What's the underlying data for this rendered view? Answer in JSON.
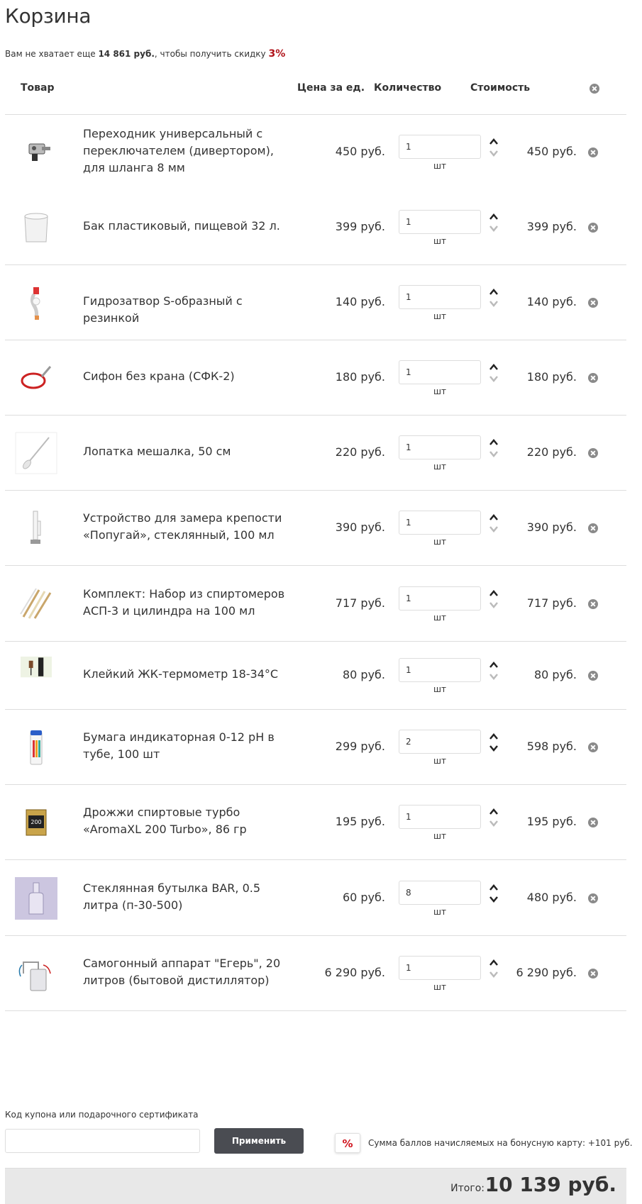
{
  "page": {
    "title": "Корзина",
    "notice_prefix": "Вам не хватает еще ",
    "notice_amount": "14 861 руб.",
    "notice_middle": ", чтобы получить скидку ",
    "notice_discount": "3%"
  },
  "table": {
    "headers": {
      "product": "Товар",
      "unit_price": "Цена за ед.",
      "quantity": "Количество",
      "cost": "Стоимость"
    },
    "rows": [
      {
        "name": "Переходник универсальный с переключателем (дивертором), для шланга 8 мм",
        "price": "450 руб.",
        "qty": "1",
        "unit": "шт",
        "total": "450 руб.",
        "icon": "adapter-image"
      },
      {
        "name": "Бак пластиковый, пищевой 32 л.",
        "price": "399 руб.",
        "qty": "1",
        "unit": "шт",
        "total": "399 руб.",
        "icon": "plastic-tank-image"
      },
      {
        "name": "Гидрозатвор S-образный с резинкой",
        "price": "140 руб.",
        "qty": "1",
        "unit": "шт",
        "total": "140 руб.",
        "icon": "airlock-image"
      },
      {
        "name": "Сифон без крана (СФК-2)",
        "price": "180 руб.",
        "qty": "1",
        "unit": "шт",
        "total": "180 руб.",
        "icon": "siphon-image"
      },
      {
        "name": "Лопатка мешалка, 50 см",
        "price": "220 руб.",
        "qty": "1",
        "unit": "шт",
        "total": "220 руб.",
        "icon": "stirrer-image"
      },
      {
        "name": "Устройство для замера крепости «Попугай», стеклянный, 100 мл",
        "price": "390 руб.",
        "qty": "1",
        "unit": "шт",
        "total": "390 руб.",
        "icon": "parrot-device-image"
      },
      {
        "name": "Комплект: Набор из спиртомеров АСП-3 и цилиндра на 100 мл",
        "price": "717 руб.",
        "qty": "1",
        "unit": "шт",
        "total": "717 руб.",
        "icon": "hydrometer-set-image"
      },
      {
        "name": "Клейкий ЖК-термометр 18-34°С",
        "price": "80 руб.",
        "qty": "1",
        "unit": "шт",
        "total": "80 руб.",
        "icon": "thermometer-image"
      },
      {
        "name": "Бумага индикаторная 0-12 рН в тубе, 100 шт",
        "price": "299 руб.",
        "qty": "2",
        "unit": "шт",
        "total": "598 руб.",
        "icon": "ph-paper-image"
      },
      {
        "name": "Дрожжи спиртовые турбо «AromaXL 200 Turbo», 86 гр",
        "price": "195 руб.",
        "qty": "1",
        "unit": "шт",
        "total": "195 руб.",
        "icon": "yeast-image"
      },
      {
        "name": "Стеклянная бутылка BAR, 0.5 литра (п-30-500)",
        "price": "60 руб.",
        "qty": "8",
        "unit": "шт",
        "total": "480 руб.",
        "icon": "bottle-image"
      },
      {
        "name": "Самогонный аппарат \"Егерь\", 20 литров (бытовой дистиллятор)",
        "price": "6 290 руб.",
        "qty": "1",
        "unit": "шт",
        "total": "6 290 руб.",
        "icon": "distiller-image"
      }
    ]
  },
  "coupon": {
    "label": "Код купона или подарочного сертификата",
    "value": "",
    "apply_label": "Применить"
  },
  "bonus": {
    "icon_text": "%",
    "text": "Сумма баллов начисляемых на бонусную карту: +101 руб."
  },
  "summary": {
    "label": "Итого:",
    "value": "10 139 руб."
  },
  "colors": {
    "discount_accent": "#b0131a",
    "button_bg": "#4a4c52",
    "footer_bg": "#e8e8e8"
  }
}
